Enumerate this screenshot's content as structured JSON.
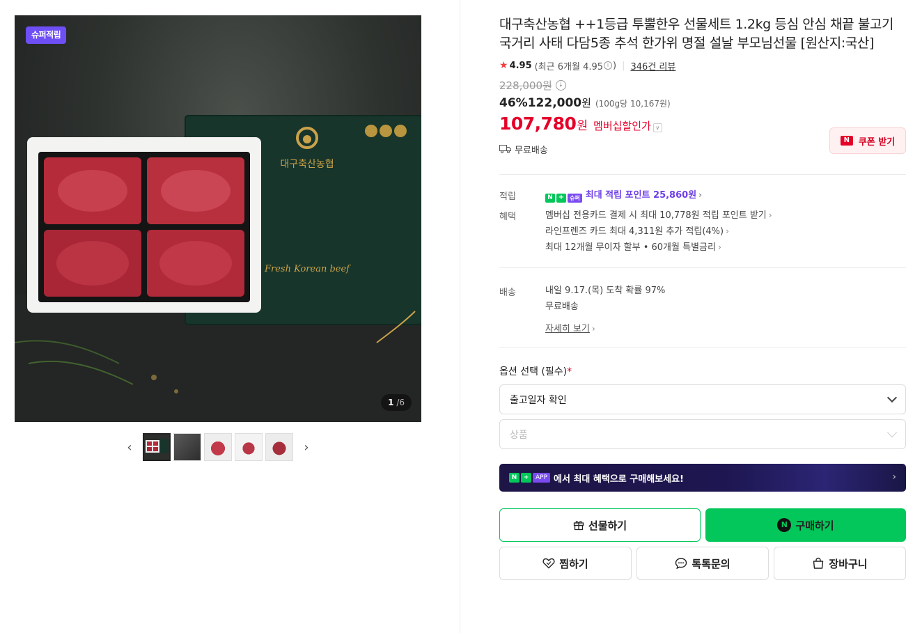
{
  "gallery": {
    "badge": "슈퍼적립",
    "brand_on_box": "대구축산농협",
    "box_script": "Fresh Korean beef",
    "counter_current": "1",
    "counter_total": "/6"
  },
  "product": {
    "title": "대구축산농협 ++1등급 투뿔한우 선물세트 1.2kg 등심 안심 채끝 불고기 국거리 사태 다담5종 추석 한가위 명절 설날 부모님선물 [원산지:국산]",
    "rating": "4.95",
    "recent_rating_text": "(최근 6개월 4.95",
    "recent_rating_close": ")",
    "review_count": "346건 리뷰",
    "original_price": "228,000원",
    "discount": "46%",
    "sale_price": "122,000",
    "sale_won": "원",
    "unit_price": "(100g당 10,167원)",
    "member_price": "107,780",
    "member_won": "원",
    "member_label": "멤버십할인가",
    "coupon_label": "쿠폰 받기",
    "shipping": "무료배송"
  },
  "benefits": {
    "points_label": "적립",
    "badge_n": "N",
    "badge_plus": "+",
    "badge_super": "슈퍼",
    "points_text": "최대 적립 포인트 25,860원",
    "perks_label": "혜택",
    "perks": [
      "멤버십 전용카드 결제 시 최대 10,778원 적립 포인트 받기",
      "라인프렌즈 카드 최대 4,311원 추가 적립(4%)",
      "최대 12개월 무이자 할부 • 60개월 특별금리"
    ]
  },
  "delivery": {
    "label": "배송",
    "arrival": "내일 9.17.(목) 도착 확률 97%",
    "fee": "무료배송",
    "detail_link": "자세히 보기"
  },
  "options": {
    "label": "옵션 선택 (필수)",
    "required_mark": "*",
    "select1": "출고일자 확인",
    "select2_placeholder": "상품"
  },
  "app_banner": {
    "app_badge": "APP",
    "text": "에서 최대 혜택으로 구매해보세요!"
  },
  "buttons": {
    "gift": "선물하기",
    "buy": "구매하기",
    "wish": "찜하기",
    "talk": "톡톡문의",
    "cart": "장바구니"
  },
  "colors": {
    "accent_green": "#03c75a",
    "price_red": "#e5002a",
    "super_purple": "#6e4ef5"
  }
}
